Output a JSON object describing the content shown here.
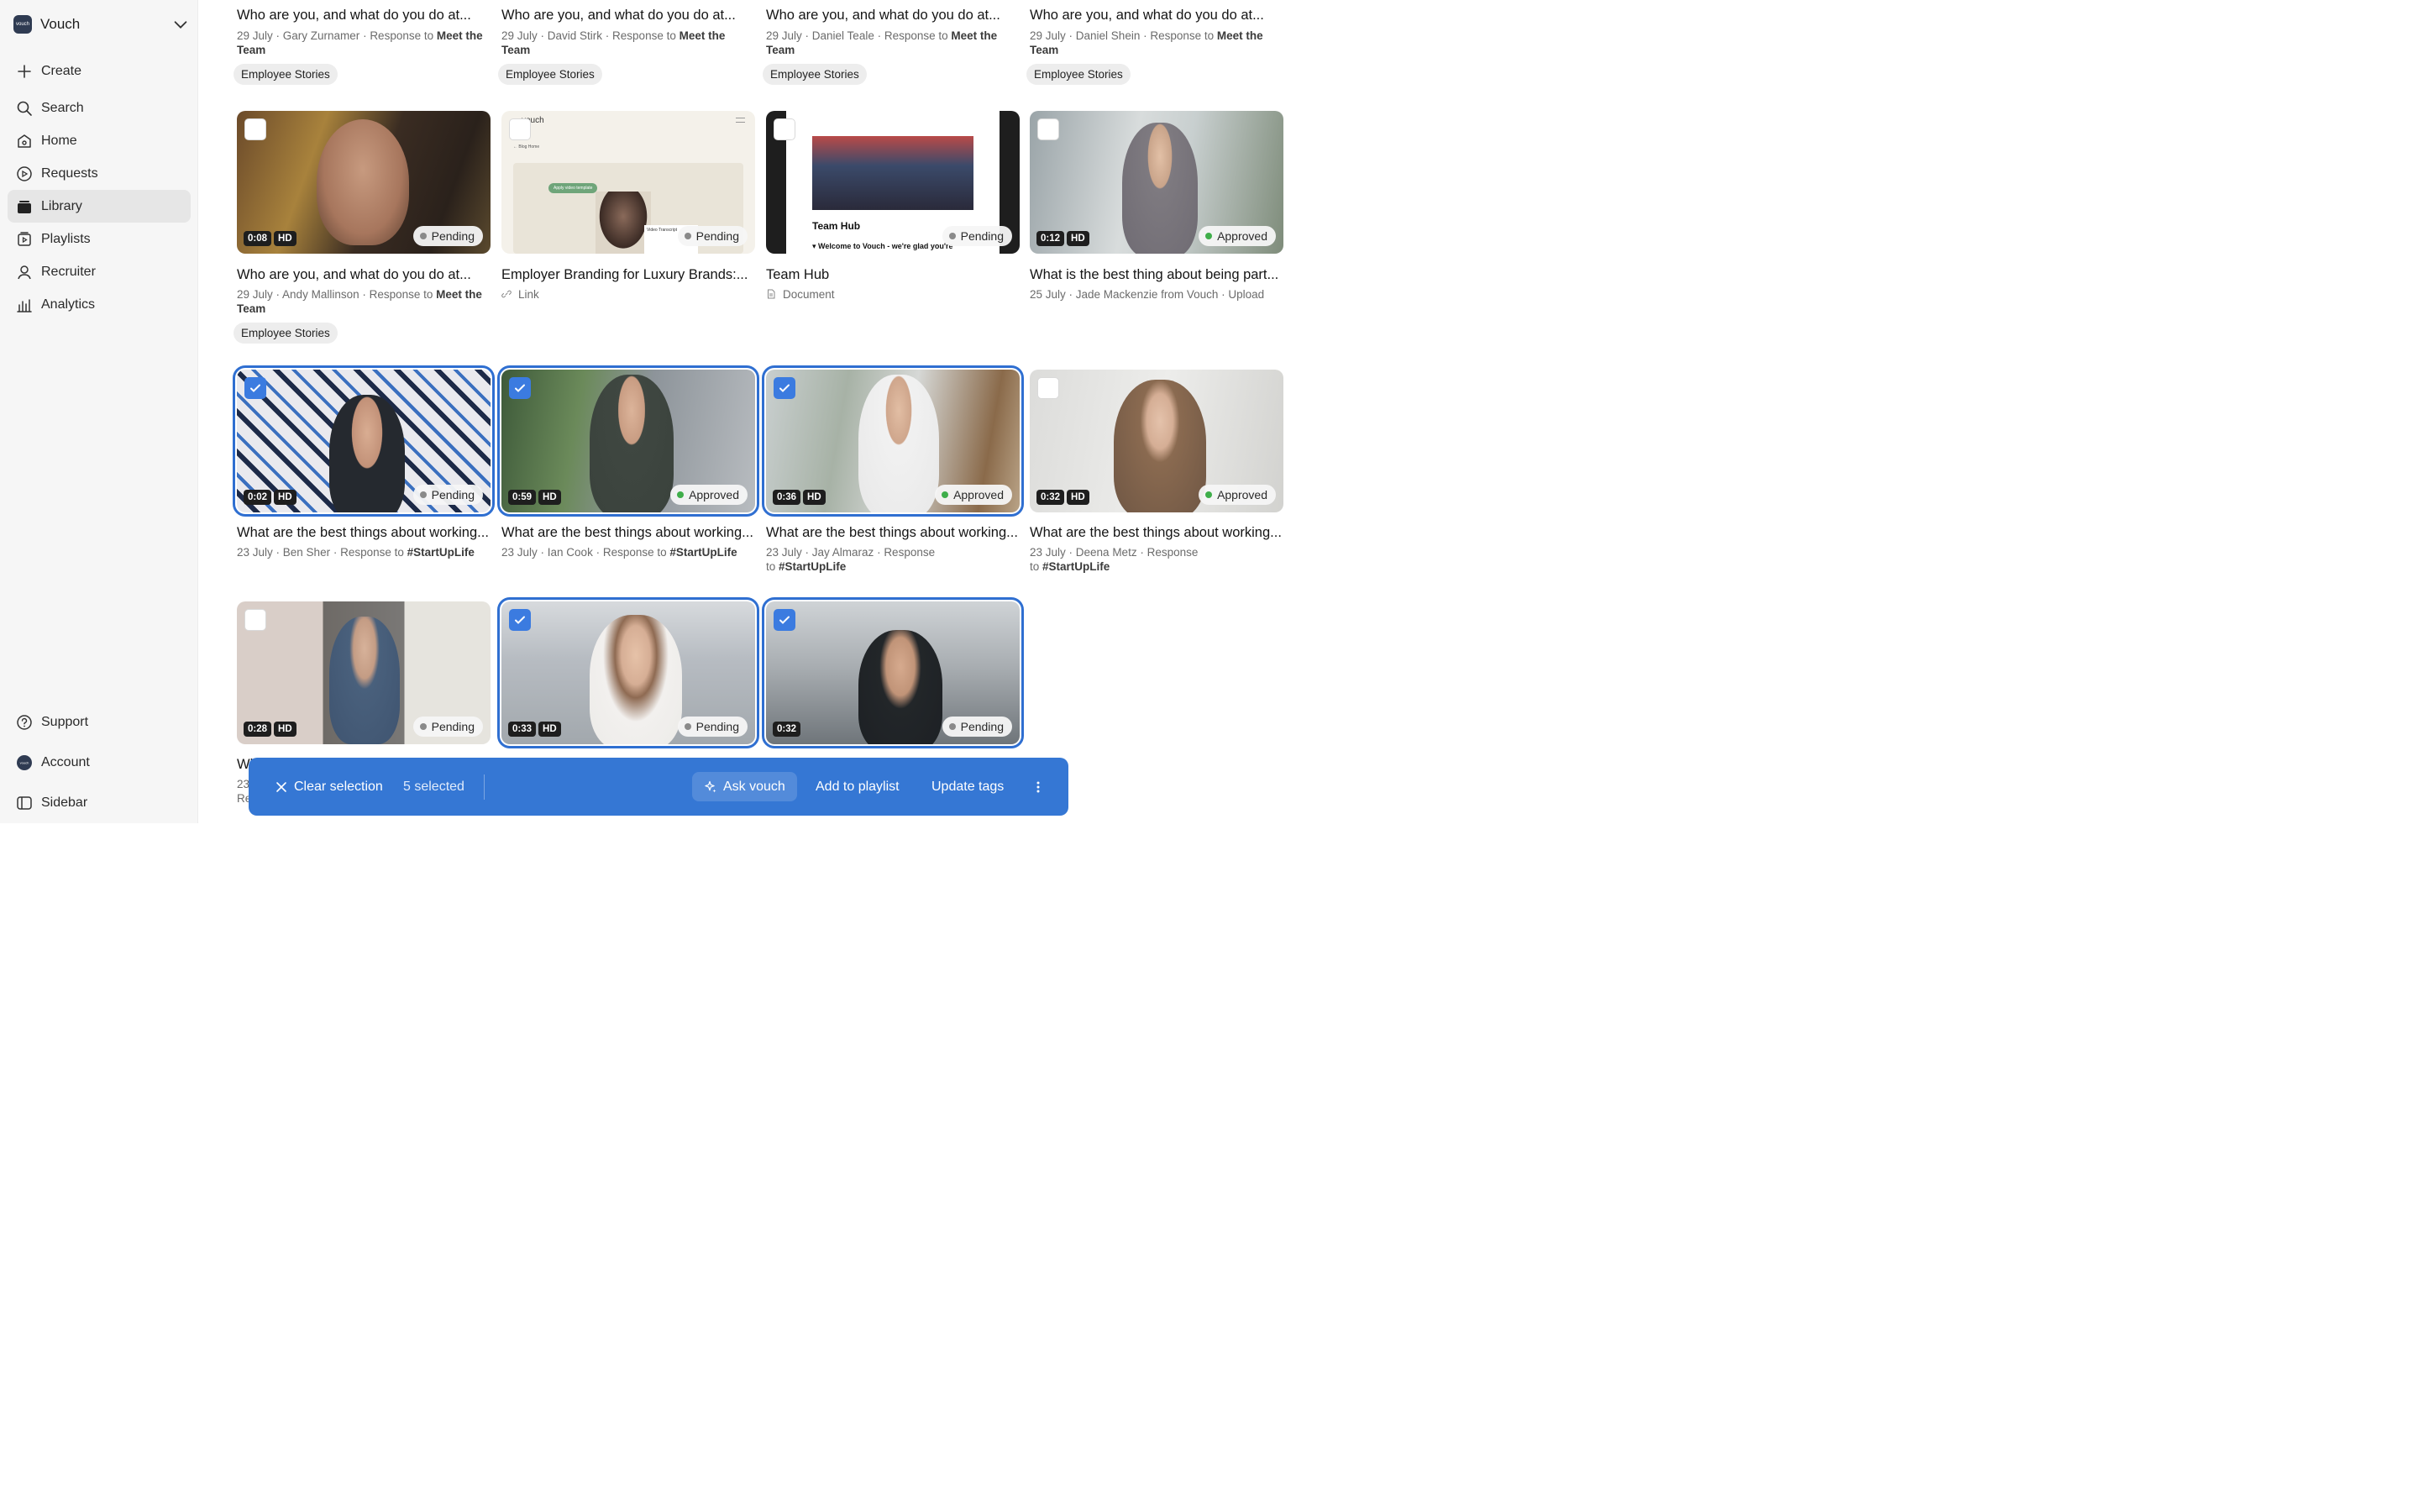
{
  "brand": {
    "name": "Vouch",
    "logo_text": "vouch"
  },
  "nav": {
    "top": [
      {
        "label": "Create",
        "icon": "plus-icon"
      },
      {
        "label": "Search",
        "icon": "search-icon"
      },
      {
        "label": "Home",
        "icon": "home-icon"
      },
      {
        "label": "Requests",
        "icon": "requests-icon"
      },
      {
        "label": "Library",
        "icon": "library-icon",
        "active": true
      },
      {
        "label": "Playlists",
        "icon": "playlist-icon"
      },
      {
        "label": "Recruiter",
        "icon": "user-icon"
      },
      {
        "label": "Analytics",
        "icon": "analytics-icon"
      }
    ],
    "bottom": [
      {
        "label": "Support",
        "icon": "help-icon"
      },
      {
        "label": "Account",
        "icon": "account-icon"
      },
      {
        "label": "Sidebar",
        "icon": "sidebar-icon"
      }
    ]
  },
  "row0": [
    {
      "title": "Who are you, and what do you do at...",
      "date": "29 July",
      "person": "Gary Zurnamer",
      "resp": "Response to",
      "target": "Meet the",
      "target2": "Team",
      "tag": "Employee Stories"
    },
    {
      "title": "Who are you, and what do you do at...",
      "date": "29 July",
      "person": "David Stirk",
      "resp": "Response to",
      "target": "Meet the",
      "target2": "Team",
      "tag": "Employee Stories"
    },
    {
      "title": "Who are you, and what do you do at...",
      "date": "29 July",
      "person": "Daniel Teale",
      "resp": "Response to",
      "target": "Meet the",
      "target2": "Team",
      "tag": "Employee Stories"
    },
    {
      "title": "Who are you, and what do you do at...",
      "date": "29 July",
      "person": "Daniel Shein",
      "resp": "Response to",
      "target": "Meet the",
      "target2": "Team",
      "tag": "Employee Stories"
    }
  ],
  "row1": [
    {
      "duration": "0:08",
      "hd": "HD",
      "status": "Pending",
      "title": "Who are you, and what do you do at...",
      "date": "29 July",
      "person": "Andy Mallinson",
      "resp": "Response to",
      "target": "Meet the",
      "target2": "Team",
      "tag": "Employee Stories",
      "checked": false
    },
    {
      "status": "Pending",
      "title": "Employer Branding for Luxury Brands:...",
      "type": "Link",
      "checked": false,
      "thumb_logo": "vouch",
      "thumb_nav": "← Blog Home",
      "thumb_chip": "Apply video template",
      "thumb_transcript": "Video Transcript"
    },
    {
      "status": "Pending",
      "title": "Team Hub",
      "type": "Document",
      "checked": false,
      "thumb_heading": "Team Hub",
      "thumb_sub": "▾ Welcome to Vouch - we're glad you're"
    },
    {
      "duration": "0:12",
      "hd": "HD",
      "status": "Approved",
      "title": "What is the best thing about being part...",
      "date": "25 July",
      "person": "Jade Mackenzie from Vouch",
      "resp": "Upload",
      "checked": false
    }
  ],
  "row2": [
    {
      "duration": "0:02",
      "hd": "HD",
      "status": "Pending",
      "title": "What are the best things about working...",
      "date": "23 July",
      "person": "Ben Sher",
      "resp": "Response to",
      "target": "#StartUpLife",
      "checked": true
    },
    {
      "duration": "0:59",
      "hd": "HD",
      "status": "Approved",
      "title": "What are the best things about working...",
      "date": "23 July",
      "person": "Ian Cook",
      "resp": "Response to",
      "target": "#StartUpLife",
      "checked": true
    },
    {
      "duration": "0:36",
      "hd": "HD",
      "status": "Approved",
      "title": "What are the best things about working...",
      "date": "23 July",
      "person": "Jay Almaraz",
      "resp": "Response",
      "resp2": "to",
      "target": "#StartUpLife",
      "checked": true
    },
    {
      "duration": "0:32",
      "hd": "HD",
      "status": "Approved",
      "title": "What are the best things about working...",
      "date": "23 July",
      "person": "Deena Metz",
      "resp": "Response",
      "resp2": "to",
      "target": "#StartUpLife",
      "checked": false
    }
  ],
  "row3": [
    {
      "duration": "0:28",
      "hd": "HD",
      "status": "Pending",
      "title_partial": "Wl",
      "meta_partial1": "23",
      "meta_partial2": "Re",
      "checked": false
    },
    {
      "duration": "0:33",
      "hd": "HD",
      "status": "Pending",
      "checked": true
    },
    {
      "duration": "0:32",
      "status": "Pending",
      "checked": true
    }
  ],
  "actionbar": {
    "clear": "Clear selection",
    "count": "5 selected",
    "ask": "Ask vouch",
    "add": "Add to playlist",
    "tags": "Update tags"
  },
  "colors": {
    "accent": "#3577d4",
    "approved": "#3fae4a",
    "pending": "#8a8a8a"
  }
}
